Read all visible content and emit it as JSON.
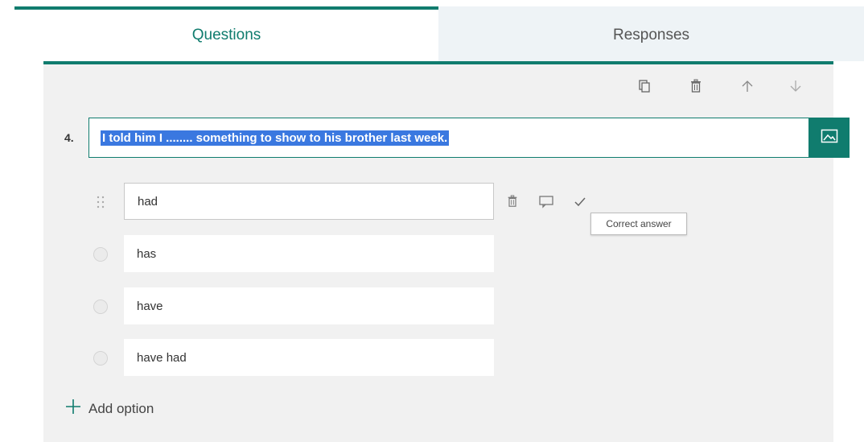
{
  "tabs": {
    "questions": "Questions",
    "responses": "Responses"
  },
  "question": {
    "number": "4.",
    "text": "I told him I ........ something to show to his brother last week."
  },
  "options": [
    {
      "label": "had"
    },
    {
      "label": "has"
    },
    {
      "label": "have"
    },
    {
      "label": "have had"
    }
  ],
  "tooltip": "Correct answer",
  "add_option": "Add option",
  "icons": {
    "toolbar": [
      "copy-icon",
      "delete-icon",
      "move-up-icon",
      "move-down-icon"
    ],
    "option_actions": [
      "delete-icon",
      "comment-icon",
      "checkmark-icon"
    ],
    "question_media": "image-icon"
  },
  "colors": {
    "accent": "#107c6e",
    "selection": "#3a78e0"
  }
}
